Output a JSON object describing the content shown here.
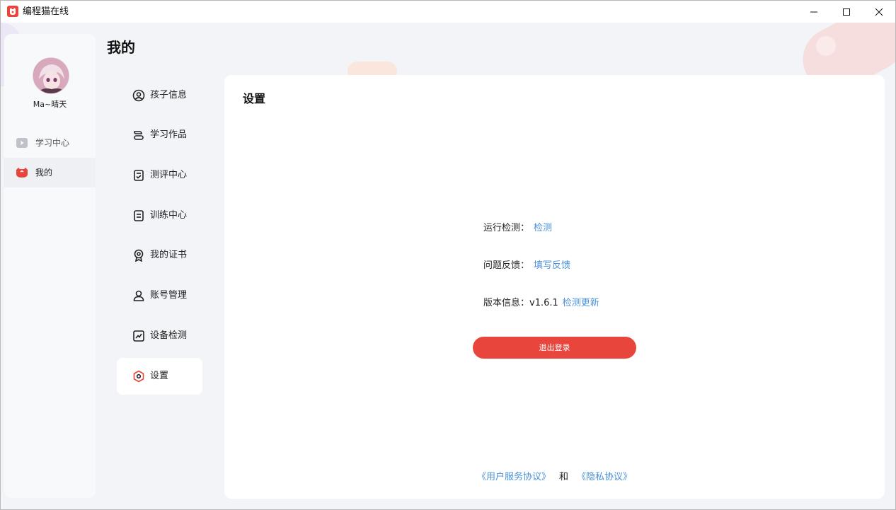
{
  "window": {
    "title": "编程猫在线"
  },
  "user": {
    "name": "Ma~晴天"
  },
  "sidebar": {
    "items": [
      {
        "label": "学习中心",
        "icon": "video-icon"
      },
      {
        "label": "我的",
        "icon": "cat-logo-icon"
      }
    ]
  },
  "page": {
    "title": "我的"
  },
  "menu": {
    "items": [
      {
        "label": "孩子信息",
        "icon": "user-circle-icon"
      },
      {
        "label": "学习作品",
        "icon": "layers-icon"
      },
      {
        "label": "测评中心",
        "icon": "clipboard-check-icon"
      },
      {
        "label": "训练中心",
        "icon": "document-icon"
      },
      {
        "label": "我的证书",
        "icon": "award-icon"
      },
      {
        "label": "账号管理",
        "icon": "user-icon"
      },
      {
        "label": "设备检测",
        "icon": "chart-line-icon"
      },
      {
        "label": "设置",
        "icon": "settings-icon"
      }
    ],
    "active_index": 7
  },
  "settings": {
    "title": "设置",
    "run_check_label": "运行检测：",
    "run_check_link": "检测",
    "feedback_label": "问题反馈：",
    "feedback_link": "填写反馈",
    "version_label": "版本信息：",
    "version_value": "v1.6.1",
    "version_link": "检测更新",
    "logout_label": "退出登录",
    "terms_link": "《用户服务协议》",
    "and_text": "和",
    "privacy_link": "《隐私协议》"
  },
  "colors": {
    "accent": "#e8453c",
    "link": "#4a90d9"
  }
}
